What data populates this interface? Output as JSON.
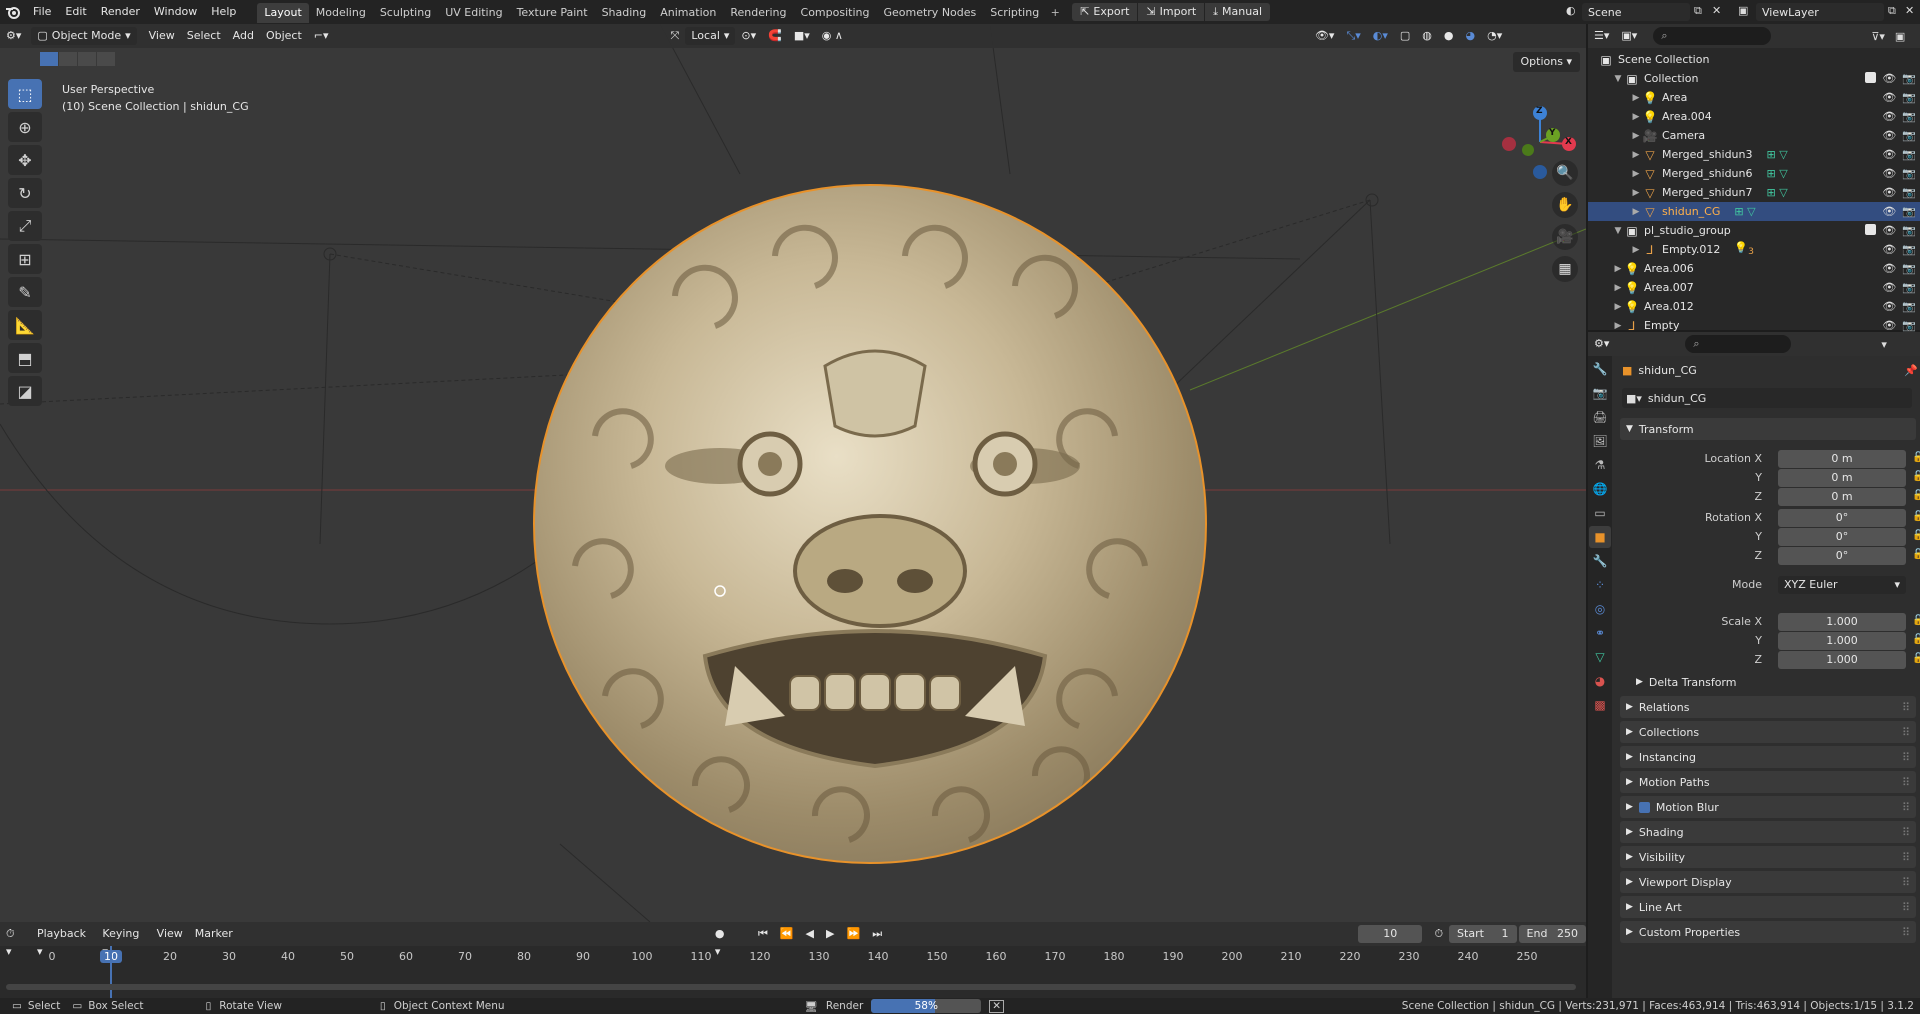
{
  "topbar": {
    "menus": [
      "File",
      "Edit",
      "Render",
      "Window",
      "Help"
    ],
    "workspaces": [
      "Layout",
      "Modeling",
      "Sculpting",
      "UV Editing",
      "Texture Paint",
      "Shading",
      "Animation",
      "Rendering",
      "Compositing",
      "Geometry Nodes",
      "Scripting"
    ],
    "active_workspace": "Layout",
    "addon_buttons": [
      "Export",
      "Import",
      "Manual"
    ],
    "scene": "Scene",
    "view_layer": "ViewLayer"
  },
  "viewport": {
    "mode": "Object Mode",
    "menus": [
      "View",
      "Select",
      "Add",
      "Object"
    ],
    "pivot": "Local",
    "options_label": "Options",
    "info_line1": "User Perspective",
    "info_line2": "(10) Scene Collection | shidun_CG",
    "gizmo_axes": [
      "Z",
      "Y",
      "X"
    ]
  },
  "timeline": {
    "menus": [
      "Playback",
      "Keying",
      "View",
      "Marker"
    ],
    "current_frame": "10",
    "start_label": "Start",
    "start": "1",
    "end_label": "End",
    "end": "250",
    "ticks": [
      "0",
      "10",
      "20",
      "30",
      "40",
      "50",
      "60",
      "70",
      "80",
      "90",
      "100",
      "110",
      "120",
      "130",
      "140",
      "150",
      "160",
      "170",
      "180",
      "190",
      "200",
      "210",
      "220",
      "230",
      "240",
      "250"
    ]
  },
  "statusbar": {
    "select": "Select",
    "box_select": "Box Select",
    "rotate_view": "Rotate View",
    "context_menu": "Object Context Menu",
    "render_label": "Render",
    "render_progress": 0.58,
    "render_progress_text": "58%",
    "stats": "Scene Collection | shidun_CG | Verts:231,971 | Faces:463,914 | Tris:463,914 | Objects:1/15 | 3.1.2"
  },
  "outliner": {
    "root": "Scene Collection",
    "rows": [
      {
        "label": "Collection",
        "type": "collection"
      },
      {
        "label": "Area",
        "type": "light"
      },
      {
        "label": "Area.004",
        "type": "light"
      },
      {
        "label": "Camera",
        "type": "camera"
      },
      {
        "label": "Merged_shidun3",
        "type": "mesh"
      },
      {
        "label": "Merged_shidun6",
        "type": "mesh"
      },
      {
        "label": "Merged_shidun7",
        "type": "mesh"
      },
      {
        "label": "shidun_CG",
        "type": "mesh"
      },
      {
        "label": "pl_studio_group",
        "type": "collection"
      },
      {
        "label": "Empty.012",
        "type": "empty"
      },
      {
        "label": "Area.006",
        "type": "light"
      },
      {
        "label": "Area.007",
        "type": "light"
      },
      {
        "label": "Area.012",
        "type": "light"
      },
      {
        "label": "Empty",
        "type": "empty"
      }
    ],
    "empty_badge": "3"
  },
  "properties": {
    "object_name": "shidun_CG",
    "data_name": "shidun_CG",
    "transform_label": "Transform",
    "location_label": "Location X",
    "rotation_label": "Rotation X",
    "scale_label": "Scale X",
    "y_label": "Y",
    "z_label": "Z",
    "mode_label": "Mode",
    "location": [
      "0 m",
      "0 m",
      "0 m"
    ],
    "rotation": [
      "0°",
      "0°",
      "0°"
    ],
    "mode": "XYZ Euler",
    "scale": [
      "1.000",
      "1.000",
      "1.000"
    ],
    "delta_transform": "Delta Transform",
    "panels": [
      "Relations",
      "Collections",
      "Instancing",
      "Motion Paths",
      "Motion Blur",
      "Shading",
      "Visibility",
      "Viewport Display",
      "Line Art",
      "Custom Properties"
    ]
  },
  "colors": {
    "accent": "#4772b3",
    "selection_outline": "#e8922a",
    "axis_x": "#e23a4e",
    "axis_y": "#6ba123",
    "axis_z": "#3d82d6"
  }
}
